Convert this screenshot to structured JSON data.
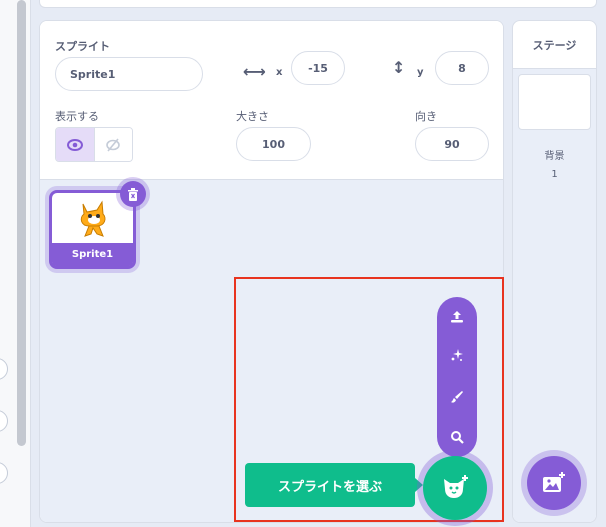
{
  "sprite_info": {
    "sprite_label": "スプライト",
    "sprite_name_value": "Sprite1",
    "x_label": "x",
    "x_value": "-15",
    "y_label": "y",
    "y_value": "8",
    "show_label": "表示する",
    "size_label": "大きさ",
    "size_value": "100",
    "direction_label": "向き",
    "direction_value": "90",
    "show_on_icon": "eye-icon",
    "show_off_icon": "eye-slash-icon"
  },
  "sprite_list": {
    "items": [
      {
        "name": "Sprite1",
        "icon": "cat-sprite-icon",
        "selected": true
      }
    ]
  },
  "sprite_actions": {
    "choose_label": "スプライトを選ぶ",
    "menu_icons": [
      "upload-icon",
      "surprise-icon",
      "paint-icon",
      "search-icon"
    ],
    "main_icon": "cat-add-icon"
  },
  "stage": {
    "title": "ステージ",
    "backdrop_label": "背景",
    "backdrop_count": "1",
    "add_backdrop_icon": "backdrop-add-icon"
  },
  "colors": {
    "accent": "#855cd6",
    "green": "#0fbd8c",
    "highlight": "#e8331f",
    "text": "#575e75",
    "pane_bg": "#e9eef8"
  }
}
